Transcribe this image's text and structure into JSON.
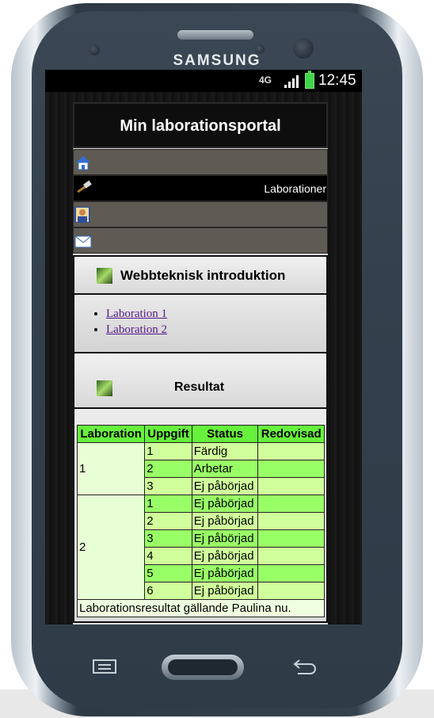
{
  "device": {
    "brand": "SAMSUNG"
  },
  "statusbar": {
    "network": "4G",
    "time": "12:45"
  },
  "site": {
    "title": "Min laborationsportal",
    "nav": [
      {
        "icon": "home-icon",
        "label": ""
      },
      {
        "icon": "hammer-icon",
        "label": "Laborationer"
      },
      {
        "icon": "person-icon",
        "label": ""
      },
      {
        "icon": "envelope-icon",
        "label": ""
      }
    ],
    "course": {
      "title": "Webbteknisk introduktion",
      "links": [
        "Laboration 1",
        "Laboration 2"
      ]
    },
    "results": {
      "title": "Resultat",
      "headers": [
        "Laboration",
        "Uppgift",
        "Status",
        "Redovisad"
      ],
      "labs": [
        {
          "lab": "1",
          "tasks": [
            {
              "task": "1",
              "status": "Färdig",
              "redovisad": ""
            },
            {
              "task": "2",
              "status": "Arbetar",
              "redovisad": ""
            },
            {
              "task": "3",
              "status": "Ej påbörjad",
              "redovisad": ""
            }
          ]
        },
        {
          "lab": "2",
          "tasks": [
            {
              "task": "1",
              "status": "Ej påbörjad",
              "redovisad": ""
            },
            {
              "task": "2",
              "status": "Ej påbörjad",
              "redovisad": ""
            },
            {
              "task": "3",
              "status": "Ej påbörjad",
              "redovisad": ""
            },
            {
              "task": "4",
              "status": "Ej påbörjad",
              "redovisad": ""
            },
            {
              "task": "5",
              "status": "Ej påbörjad",
              "redovisad": ""
            },
            {
              "task": "6",
              "status": "Ej påbörjad",
              "redovisad": ""
            }
          ]
        }
      ],
      "caption": "Laborationsresultat gällande Paulina nu."
    }
  },
  "colors": {
    "header_green": "#66f23c",
    "row_green": "#99ff66",
    "row_light": "#d0ff9c"
  }
}
